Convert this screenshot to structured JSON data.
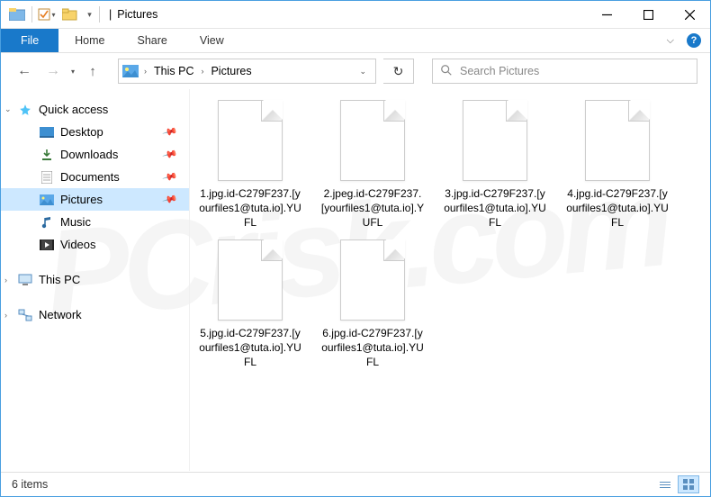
{
  "title_sep": "|",
  "window_title": "Pictures",
  "ribbon": {
    "file": "File",
    "tabs": [
      "Home",
      "Share",
      "View"
    ]
  },
  "breadcrumb": {
    "root": "This PC",
    "current": "Pictures"
  },
  "search": {
    "placeholder": "Search Pictures"
  },
  "sidebar": {
    "quick_access": "Quick access",
    "items": [
      {
        "label": "Desktop",
        "icon": "desktop",
        "pinned": true
      },
      {
        "label": "Downloads",
        "icon": "downloads",
        "pinned": true
      },
      {
        "label": "Documents",
        "icon": "documents",
        "pinned": true
      },
      {
        "label": "Pictures",
        "icon": "pictures",
        "pinned": true,
        "selected": true
      },
      {
        "label": "Music",
        "icon": "music",
        "pinned": false
      },
      {
        "label": "Videos",
        "icon": "videos",
        "pinned": false
      }
    ],
    "this_pc": "This PC",
    "network": "Network"
  },
  "files": [
    {
      "name": "1.jpg.id-C279F237.[yourfiles1@tuta.io].YUFL"
    },
    {
      "name": "2.jpeg.id-C279F237.[yourfiles1@tuta.io].YUFL"
    },
    {
      "name": "3.jpg.id-C279F237.[yourfiles1@tuta.io].YUFL"
    },
    {
      "name": "4.jpg.id-C279F237.[yourfiles1@tuta.io].YUFL"
    },
    {
      "name": "5.jpg.id-C279F237.[yourfiles1@tuta.io].YUFL"
    },
    {
      "name": "6.jpg.id-C279F237.[yourfiles1@tuta.io].YUFL"
    }
  ],
  "status": {
    "count_text": "6 items"
  }
}
